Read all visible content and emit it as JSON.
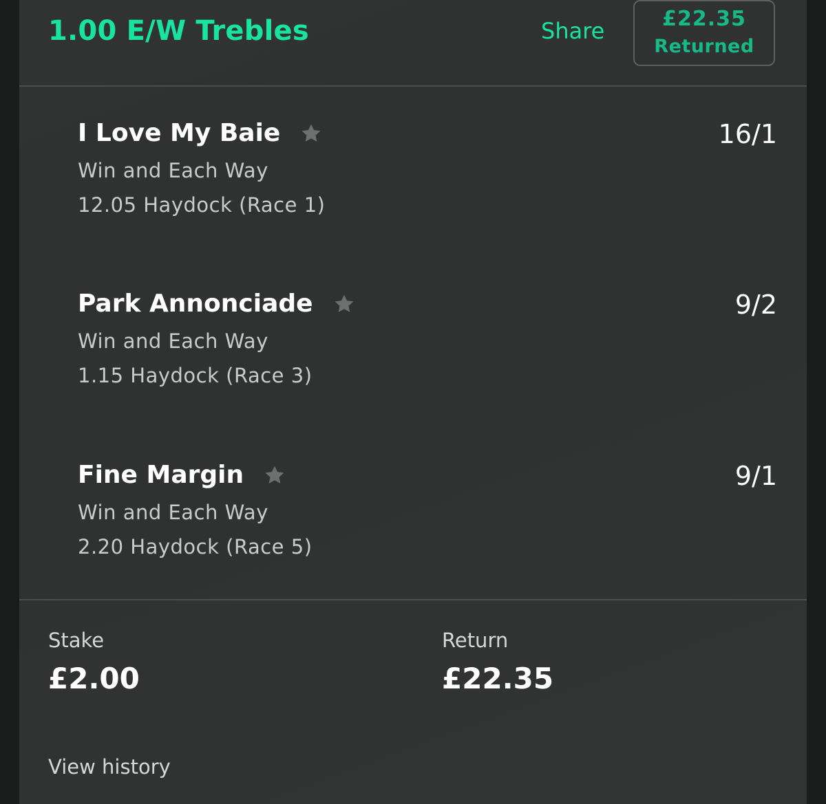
{
  "colors": {
    "accent": "#19e3a0",
    "accent_dim": "#17b987",
    "card_bg": "#303332",
    "outer_bg": "#1b1c1c",
    "text_primary": "#ffffff",
    "text_secondary": "#c9cccb",
    "star": "#6c706e"
  },
  "header": {
    "title": "1.00 E/W Trebles",
    "share_label": "Share",
    "returned_amount": "£22.35",
    "returned_label": "Returned"
  },
  "selections": [
    {
      "name": "I Love My Baie",
      "icon": "star-icon",
      "market": "Win and Each Way",
      "race": "12.05 Haydock (Race 1)",
      "odds": "16/1"
    },
    {
      "name": "Park Annonciade",
      "icon": "star-icon",
      "market": "Win and Each Way",
      "race": "1.15 Haydock (Race 3)",
      "odds": "9/2"
    },
    {
      "name": "Fine Margin",
      "icon": "star-icon",
      "market": "Win and Each Way",
      "race": "2.20 Haydock (Race 5)",
      "odds": "9/1"
    }
  ],
  "summary": {
    "stake_label": "Stake",
    "stake_value": "£2.00",
    "return_label": "Return",
    "return_value": "£22.35"
  },
  "footer": {
    "view_history_label": "View history"
  }
}
